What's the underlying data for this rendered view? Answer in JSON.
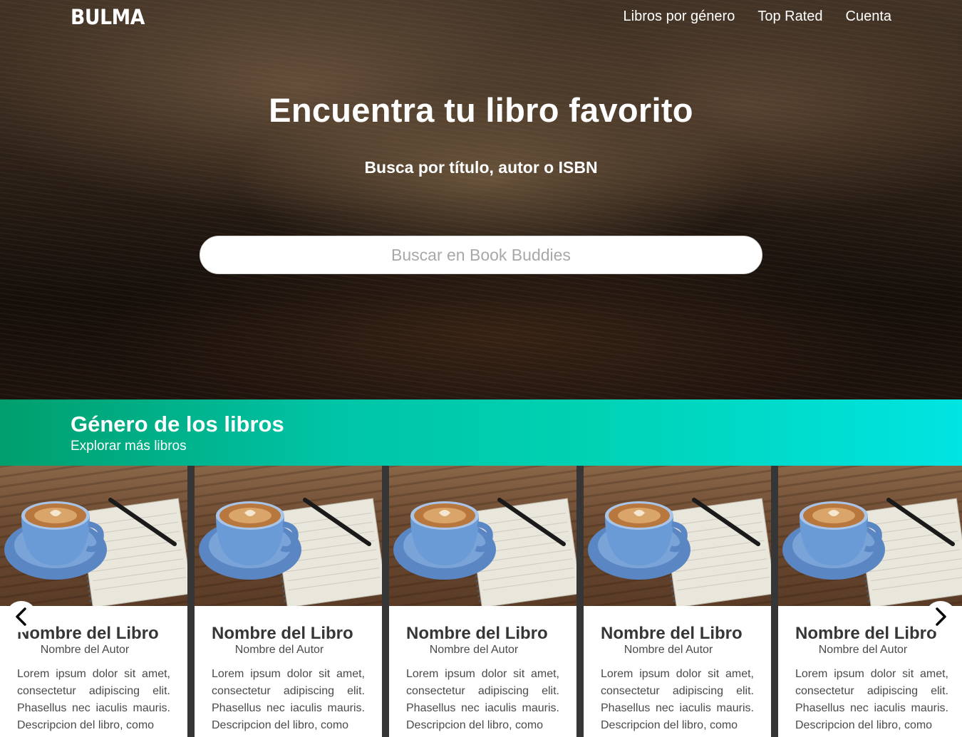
{
  "navbar": {
    "brand": "BULMA",
    "items": [
      {
        "label": "Libros por género"
      },
      {
        "label": "Top Rated"
      },
      {
        "label": "Cuenta"
      }
    ]
  },
  "hero": {
    "title": "Encuentra tu libro favorito",
    "subtitle": "Busca por título, autor o ISBN",
    "search_placeholder": "Buscar en Book Buddies",
    "search_value": ""
  },
  "genre": {
    "title": "Género de los libros",
    "subtitle": "Explorar más libros"
  },
  "carousel": {
    "prev_icon": "chevron-left-icon",
    "next_icon": "chevron-right-icon",
    "cards": [
      {
        "title": "Nombre del Libro",
        "author": "Nombre del Autor",
        "description": "Lorem ipsum dolor sit amet, consectetur adipiscing elit. Phasellus nec iaculis mauris. Descripcion del libro, como"
      },
      {
        "title": "Nombre del Libro",
        "author": "Nombre del Autor",
        "description": "Lorem ipsum dolor sit amet, consectetur adipiscing elit. Phasellus nec iaculis mauris. Descripcion del libro, como"
      },
      {
        "title": "Nombre del Libro",
        "author": "Nombre del Autor",
        "description": "Lorem ipsum dolor sit amet, consectetur adipiscing elit. Phasellus nec iaculis mauris. Descripcion del libro, como"
      },
      {
        "title": "Nombre del Libro",
        "author": "Nombre del Autor",
        "description": "Lorem ipsum dolor sit amet, consectetur adipiscing elit. Phasellus nec iaculis mauris. Descripcion del libro, como"
      },
      {
        "title": "Nombre del Libro",
        "author": "Nombre del Autor",
        "description": "Lorem ipsum dolor sit amet, consectetur adipiscing elit. Phasellus nec iaculis mauris. Descripcion del libro, como"
      }
    ]
  },
  "colors": {
    "accent_start": "#009e6c",
    "accent_end": "#00e4e2",
    "card_gap": "#363636"
  }
}
